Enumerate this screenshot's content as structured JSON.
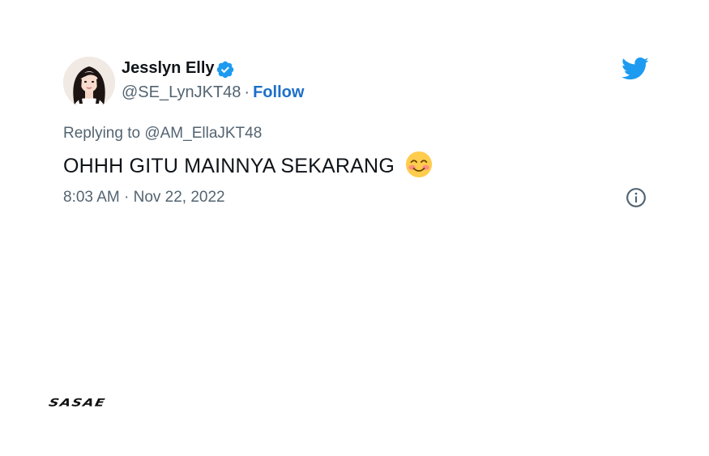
{
  "author": {
    "display_name": "Jesslyn Elly",
    "handle": "@SE_LynJKT48",
    "separator": "·",
    "follow_label": "Follow",
    "verified": true
  },
  "reply": {
    "prefix": "Replying to ",
    "target": "@AM_EllaJKT48"
  },
  "tweet": {
    "text": "OHHH GITU MAINNYA SEKARANG",
    "emoji": "smiling-face-with-smiling-eyes-icon"
  },
  "meta": {
    "timestamp": "8:03 AM · Nov 22, 2022"
  },
  "watermark": {
    "text": "SASAE"
  },
  "colors": {
    "twitter_blue": "#1d9bf0",
    "follow_blue": "#1d6fc9",
    "secondary_text": "#536471",
    "primary_text": "#0f1419"
  },
  "icons": {
    "brand": "twitter-bird-icon",
    "verified": "verified-badge-icon",
    "info": "info-icon"
  }
}
